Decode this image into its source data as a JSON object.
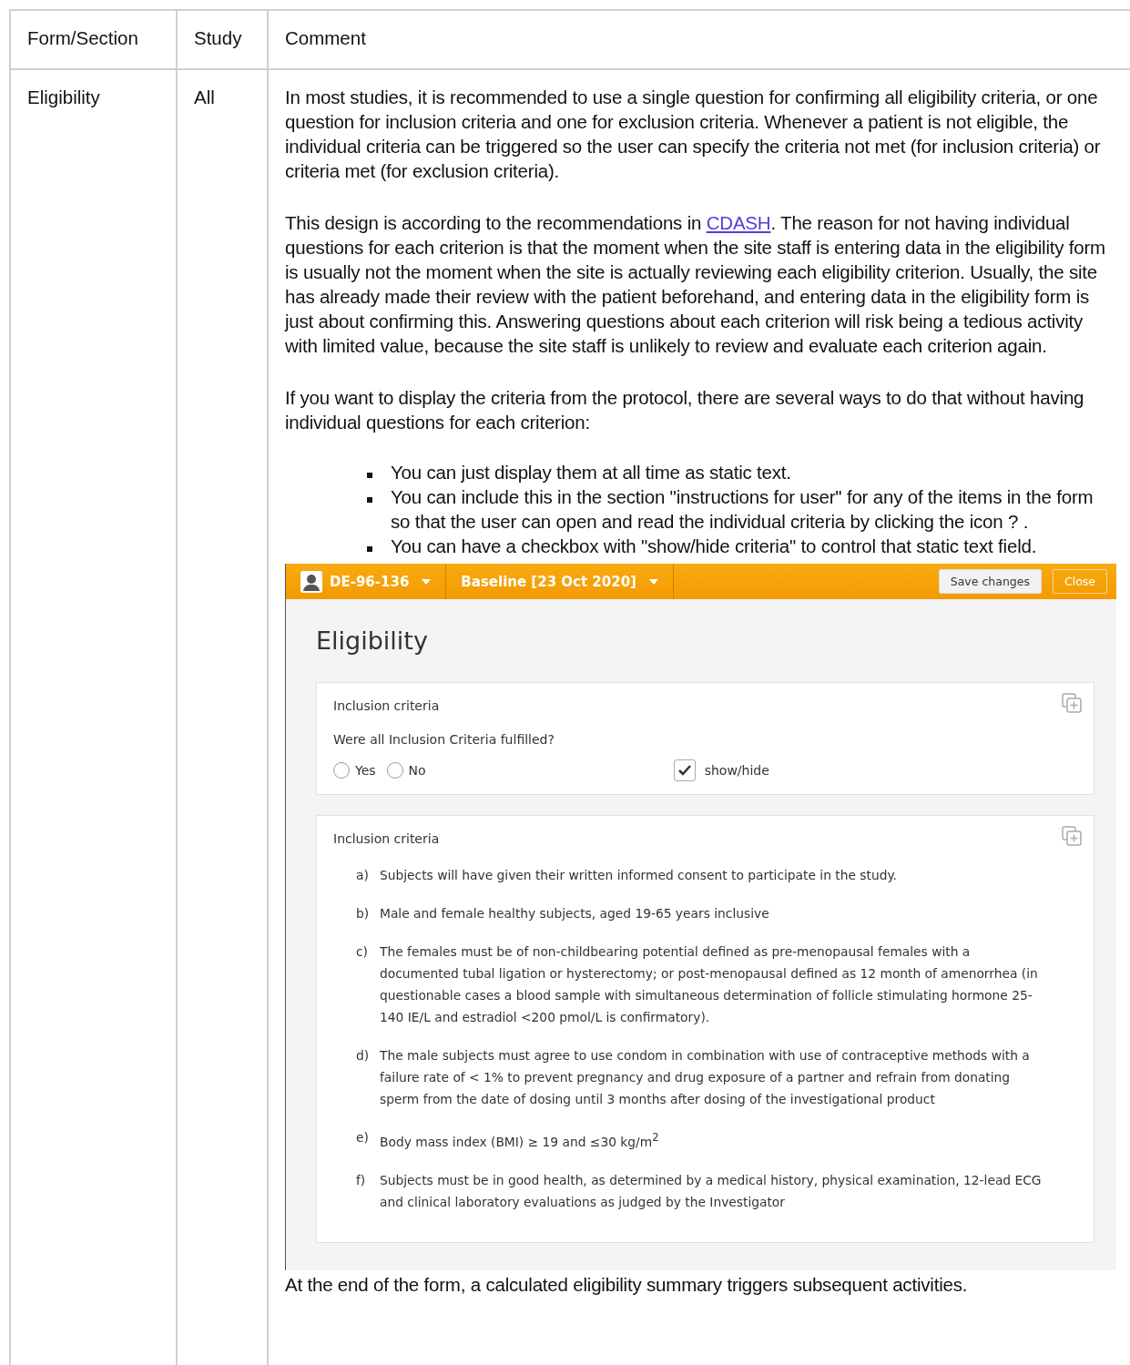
{
  "table": {
    "columns": [
      "Form/Section",
      "Study",
      "Comment"
    ],
    "rows": [
      {
        "form_section": "Eligibility",
        "study": "All",
        "comment": {
          "paragraphs": [
            {
              "before": "In most studies, it is recommended to use a single question for confirming all eligibility criteria, or one question for inclusion criteria and one for exclusion criteria. Whenever a patient is not eligible, the individual criteria can be triggered so the user can specify the criteria not met (for inclusion criteria) or criteria met (for exclusion criteria)."
            },
            {
              "before": "This design is according to the recommendations in ",
              "link": "CDASH",
              "after": ". The reason for not having individual questions for each criterion is that the moment when the site staff is entering data in the eligibility form is usually not the moment when the site is actually reviewing each eligibility criterion. Usually, the site has already made their review with the patient beforehand, and entering data in the eligibility form is just about confirming this. Answering questions about each criterion will risk being a tedious activity with limited value, because the site staff is unlikely to review and evaluate each criterion again."
            },
            {
              "before": "If you want to display the criteria from the protocol, there are several ways to do that without having individual questions for each criterion:"
            }
          ],
          "bullets": [
            "You can just display them at all time as static text.",
            "You can include this in the section \"instructions for user\" for any of the items in the form so that the user can open and read the individual criteria by clicking the icon   ?  .",
            "You can have a checkbox with \"show/hide criteria\" to control that static text field."
          ],
          "screenshot": {
            "subject": "DE-96-136",
            "visit": "Baseline [23 Oct 2020]",
            "buttons": [
              "Save changes",
              "Close"
            ],
            "title": "Eligibility",
            "question_card": {
              "title": "Inclusion criteria",
              "question": "Were all Inclusion Criteria fulfilled?",
              "options": [
                {
                  "label": "Yes",
                  "selected": false
                },
                {
                  "label": "No",
                  "selected": false
                }
              ],
              "checkbox": {
                "label": "show/hide",
                "checked": true
              }
            },
            "criteria_card": {
              "title": "Inclusion criteria",
              "criteria": [
                {
                  "marker": "a)",
                  "text": "Subjects will have given their written informed consent to participate in the study."
                },
                {
                  "marker": "b)",
                  "text": "Male and female healthy subjects, aged 19-65 years inclusive"
                },
                {
                  "marker": "c)",
                  "text": "The females must be of non-childbearing potential defined as pre-menopausal females with a documented tubal ligation or hysterectomy; or post-menopausal defined as 12 month of amenorrhea (in questionable cases a blood sample with simultaneous determination of follicle stimulating hormone 25-140 IE/L and estradiol <200 pmol/L is confirmatory)."
                },
                {
                  "marker": "d)",
                  "text": "The male subjects must agree to use condom in combination with use of contraceptive methods with a failure rate of < 1% to prevent pregnancy and drug exposure of a partner and refrain from donating sperm from the date of dosing until 3 months after dosing of the investigational product"
                },
                {
                  "marker": "e)",
                  "text": "Body mass index (BMI) ≥ 19 and  ≤30 kg/m$^{2}$"
                },
                {
                  "marker": "f)",
                  "text": "Subjects must be in good health, as determined by a medical history, physical examination, 12-lead ECG and clinical laboratory evaluations as judged by the Investigator"
                }
              ]
            }
          },
          "closing": "At the end of the form, a calculated eligibility summary triggers subsequent activities."
        }
      }
    ]
  }
}
